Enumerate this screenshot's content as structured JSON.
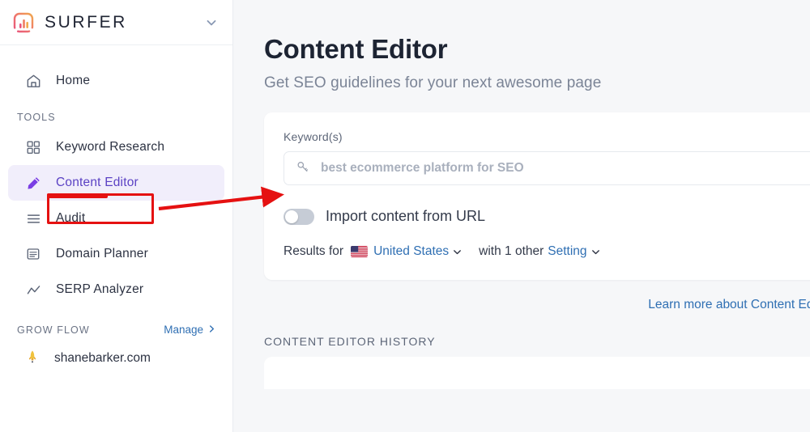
{
  "brand": {
    "name": "SURFER",
    "logo_icon": "surfer-bar-chart-logo",
    "chevron_icon": "chevron-down-icon"
  },
  "sidebar": {
    "home": {
      "label": "Home",
      "icon": "home-icon"
    },
    "tools_heading": "TOOLS",
    "tools": [
      {
        "label": "Keyword Research",
        "icon": "grid-squares-icon",
        "active": false
      },
      {
        "label": "Content Editor",
        "icon": "pencil-icon",
        "active": true
      },
      {
        "label": "Audit",
        "icon": "list-lines-icon",
        "active": false
      },
      {
        "label": "Domain Planner",
        "icon": "document-icon",
        "active": false
      },
      {
        "label": "SERP Analyzer",
        "icon": "line-chart-icon",
        "active": false
      }
    ],
    "grow_flow": {
      "heading": "GROW FLOW",
      "manage_label": "Manage",
      "manage_chevron": "chevron-right-icon",
      "site": {
        "label": "shanebarker.com",
        "icon": "rocket-icon"
      }
    }
  },
  "main": {
    "title": "Content Editor",
    "subtitle": "Get SEO guidelines for your next awesome page",
    "keyword_card": {
      "field_label": "Keyword(s)",
      "input_icon": "key-icon",
      "input_value": "",
      "input_placeholder": "best ecommerce platform for SEO",
      "toggle": {
        "label": "Import content from URL",
        "state": "off"
      },
      "results": {
        "lead": "Results for",
        "country": "United States",
        "country_flag": "us-flag-icon",
        "country_chevron": "chevron-down-icon",
        "middle": "with 1 other",
        "setting_link": "Setting",
        "setting_chevron": "chevron-down-icon"
      }
    },
    "learn_more": {
      "label": "Learn more about Content Editor",
      "chevron": "chevron-right-icon"
    },
    "history_heading": "CONTENT EDITOR HISTORY"
  },
  "annotations": {
    "highlight_color": "#e51111",
    "box_target": "Content Editor",
    "arrow_target": "keyword-input"
  },
  "colors": {
    "accent_purple": "#7b3fe4",
    "link_blue": "#2f6fb3",
    "page_bg": "#f6f7f9",
    "annotation_red": "#e51111"
  }
}
